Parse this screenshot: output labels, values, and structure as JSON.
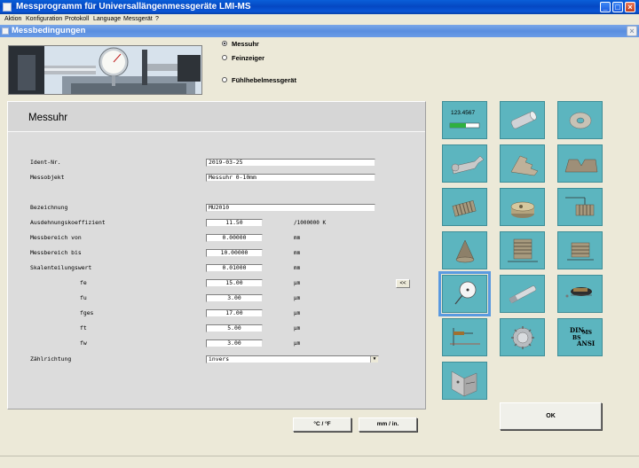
{
  "window": {
    "title": "Messprogramm für Universallängenmessgeräte LMI-MS"
  },
  "menu": [
    "Aktion",
    "Konfiguration",
    "Protokoll",
    "Language",
    "Messgerät",
    "?"
  ],
  "dialog": {
    "title": "Messbedingungen"
  },
  "device_options": [
    {
      "label": "Messuhr",
      "selected": true
    },
    {
      "label": "Feinzeiger",
      "selected": false
    },
    {
      "label": "Fühlhebelmessgerät",
      "selected": false
    }
  ],
  "panel": {
    "title": "Messuhr",
    "ident_label": "Ident-Nr.",
    "ident_value": "2019-03-25",
    "objekt_label": "Messobjekt",
    "objekt_value": "Messuhr 0-10mm",
    "bezeichnung_label": "Bezeichnung",
    "bezeichnung_value": "MU2010",
    "ausdehnung_label": "Ausdehnungskoeffizient",
    "ausdehnung_value": "11.50",
    "ausdehnung_unit": "/1000000 K",
    "von_label": "Messbereich von",
    "von_value": "0.00000",
    "von_unit": "mm",
    "bis_label": "Messbereich bis",
    "bis_value": "10.00000",
    "bis_unit": "mm",
    "skala_label": "Skalenteilungswert",
    "skala_value": "0.01000",
    "skala_unit": "mm",
    "fe_label": "fe",
    "fe_value": "15.00",
    "fu_label": "fu",
    "fu_value": "3.00",
    "fges_label": "fges",
    "fges_value": "17.00",
    "ft_label": "ft",
    "ft_value": "5.00",
    "fw_label": "fw",
    "fw_value": "3.00",
    "micro_unit": "µm",
    "zaehl_label": "Zählrichtung",
    "zaehl_value": "invers",
    "arrow_btn": "<<"
  },
  "buttons": {
    "temp": "°C / °F",
    "length": "mm / in.",
    "ok": "OK"
  },
  "tiles": {
    "readout": "123.4567",
    "standard_labels": [
      "DIN",
      "MS",
      "BS",
      "ANSI"
    ],
    "items": [
      "display-readout",
      "cylinder-pin",
      "ring-gauge",
      "wrench-gauge",
      "step-block",
      "v-block",
      "thread-plug",
      "disc-gauge",
      "thread-hook",
      "cone-gauge",
      "thread-ring",
      "thread-stand",
      "dial-indicator",
      "gauge-pin",
      "lever-probe",
      "height-probe",
      "gear",
      "standards",
      "angle-plate"
    ]
  },
  "colors": {
    "tile": "#5cb5bf",
    "selection": "#5a9ae0",
    "titlebar": "#0548c3"
  }
}
